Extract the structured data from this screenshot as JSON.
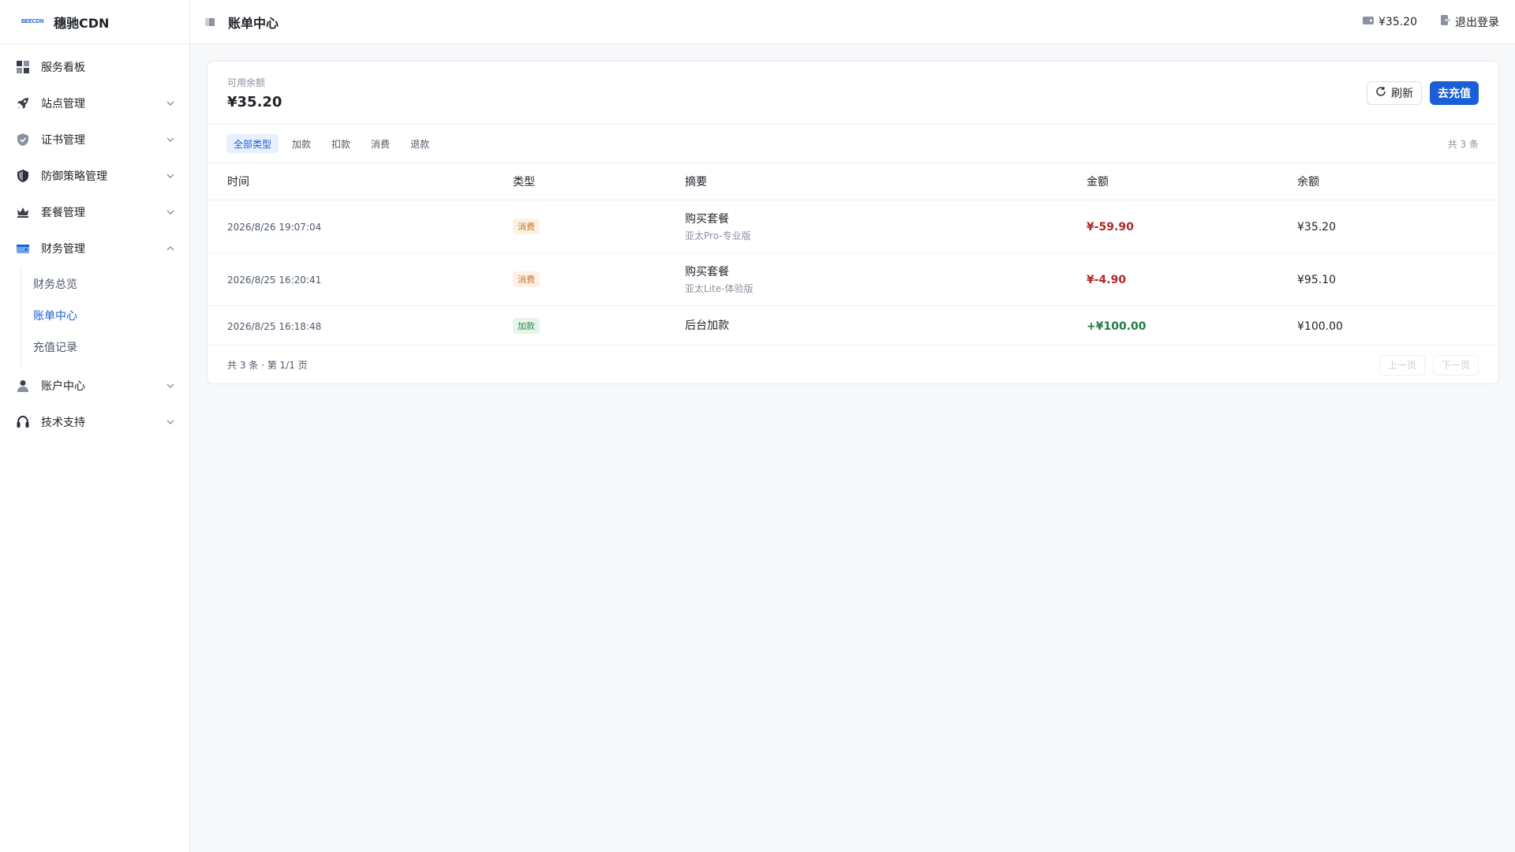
{
  "brand": {
    "logo_text": "BEECDN",
    "name": "穗驰CDN"
  },
  "sidebar": {
    "items": [
      {
        "label": "服务看板",
        "icon": "dashboard-icon"
      },
      {
        "label": "站点管理",
        "icon": "rocket-icon"
      },
      {
        "label": "证书管理",
        "icon": "shield-check-icon"
      },
      {
        "label": "防御策略管理",
        "icon": "defense-shield-icon"
      },
      {
        "label": "套餐管理",
        "icon": "crown-icon"
      },
      {
        "label": "财务管理",
        "icon": "wallet-icon"
      },
      {
        "label": "账户中心",
        "icon": "user-icon"
      },
      {
        "label": "技术支持",
        "icon": "headset-icon"
      }
    ],
    "finance_sub": [
      {
        "label": "财务总览"
      },
      {
        "label": "账单中心"
      },
      {
        "label": "充值记录"
      }
    ]
  },
  "header": {
    "title": "账单中心",
    "balance": "¥35.20",
    "logout": "退出登录"
  },
  "balance_card": {
    "label": "可用余额",
    "value": "¥35.20",
    "refresh_label": "刷新",
    "recharge_label": "去充值"
  },
  "filters": {
    "tabs": [
      "全部类型",
      "加款",
      "扣款",
      "消费",
      "退款"
    ],
    "count": "共 3 条"
  },
  "table": {
    "headers": [
      "时间",
      "类型",
      "摘要",
      "金额",
      "余额"
    ],
    "rows": [
      {
        "time": "2026/8/26 19:07:04",
        "type": "消费",
        "summary": "购买套餐",
        "detail": "亚太Pro-专业版",
        "amount": "¥-59.90",
        "balance": "¥35.20"
      },
      {
        "time": "2026/8/25 16:20:41",
        "type": "消费",
        "summary": "购买套餐",
        "detail": "亚太Lite-体验版",
        "amount": "¥-4.90",
        "balance": "¥95.10"
      },
      {
        "time": "2026/8/25 16:18:48",
        "type": "加款",
        "summary": "后台加款",
        "detail": "",
        "amount": "+¥100.00",
        "balance": "¥100.00"
      }
    ]
  },
  "pager": {
    "info": "共 3 条 · 第 1/1 页",
    "prev": "上一页",
    "next": "下一页"
  },
  "colors": {
    "accent": "#1a5fd6",
    "negative": "#b02a2a",
    "positive": "#1e7d45"
  }
}
